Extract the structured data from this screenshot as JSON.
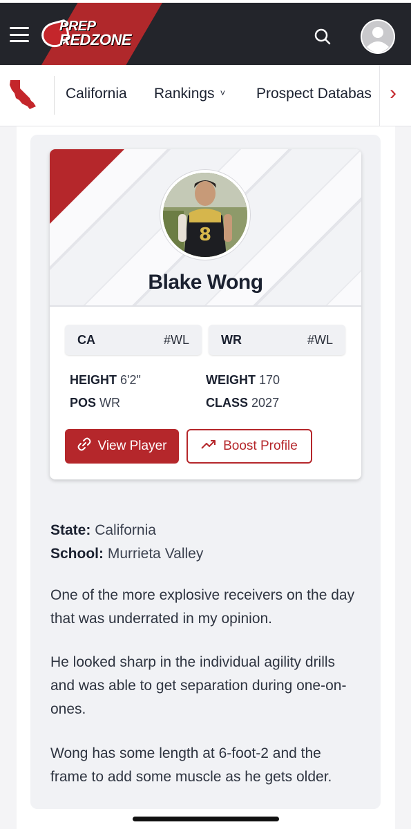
{
  "header": {
    "logo": {
      "line1": "PREP",
      "line2": "REDZONE"
    },
    "icons": {
      "menu": "hamburger-icon",
      "search": "search-icon",
      "account": "user-avatar-icon"
    }
  },
  "subnav": {
    "state_icon": "california-state-icon",
    "items": [
      {
        "label": "California"
      },
      {
        "label": "Rankings",
        "chevron": "˅"
      },
      {
        "label": "Prospect Databas"
      }
    ],
    "scroll_glyph": "›"
  },
  "player": {
    "name": "Blake Wong",
    "ranks": [
      {
        "key": "CA",
        "value": "#WL"
      },
      {
        "key": "WR",
        "value": "#WL"
      }
    ],
    "stats": {
      "height_label": "HEIGHT",
      "height": "6'2\"",
      "weight_label": "WEIGHT",
      "weight": "170",
      "pos_label": "POS",
      "pos": "WR",
      "class_label": "CLASS",
      "class": "2027"
    },
    "buttons": {
      "view": "View Player",
      "boost": "Boost Profile"
    }
  },
  "article": {
    "state_label": "State:",
    "state": "California",
    "school_label": "School:",
    "school": "Murrieta Valley",
    "paragraphs": [
      "One of the more explosive receivers on the day that was underrated in my opinion.",
      "He looked sharp in the individual agility drills and was able to get separation during one-on-ones.",
      "Wong has some length at 6-foot-2 and the frame to add some muscle as he gets older."
    ]
  },
  "colors": {
    "brand_red": "#b5272b",
    "header_dark": "#23252b"
  }
}
